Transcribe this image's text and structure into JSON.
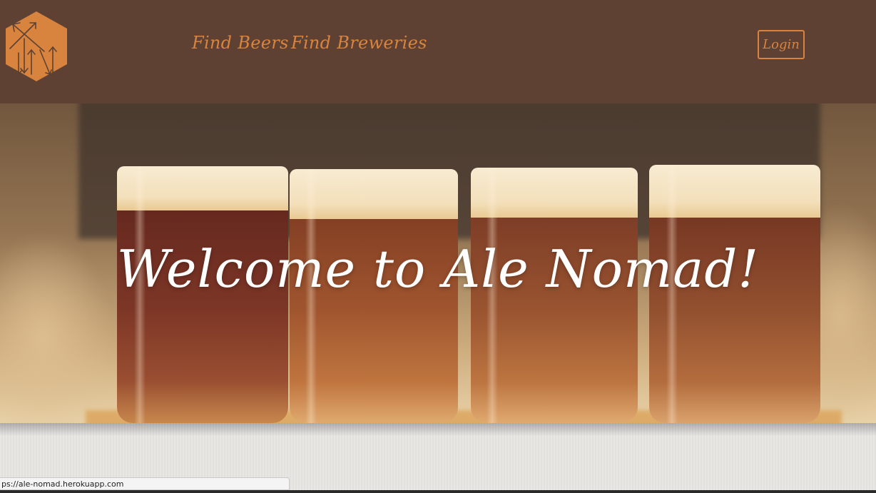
{
  "header": {
    "logo_icon": "arrows-hexagon-logo-icon",
    "nav": [
      {
        "label": "Find Beers"
      },
      {
        "label": "Find Breweries"
      }
    ],
    "login_label": "Login"
  },
  "hero": {
    "title": "Welcome to Ale Nomad!"
  },
  "status_bar": {
    "url": "ps://ale-nomad.herokuapp.com"
  },
  "colors": {
    "header_bg": "#5e4132",
    "accent": "#d8843f",
    "hero_title": "#ffffff"
  }
}
